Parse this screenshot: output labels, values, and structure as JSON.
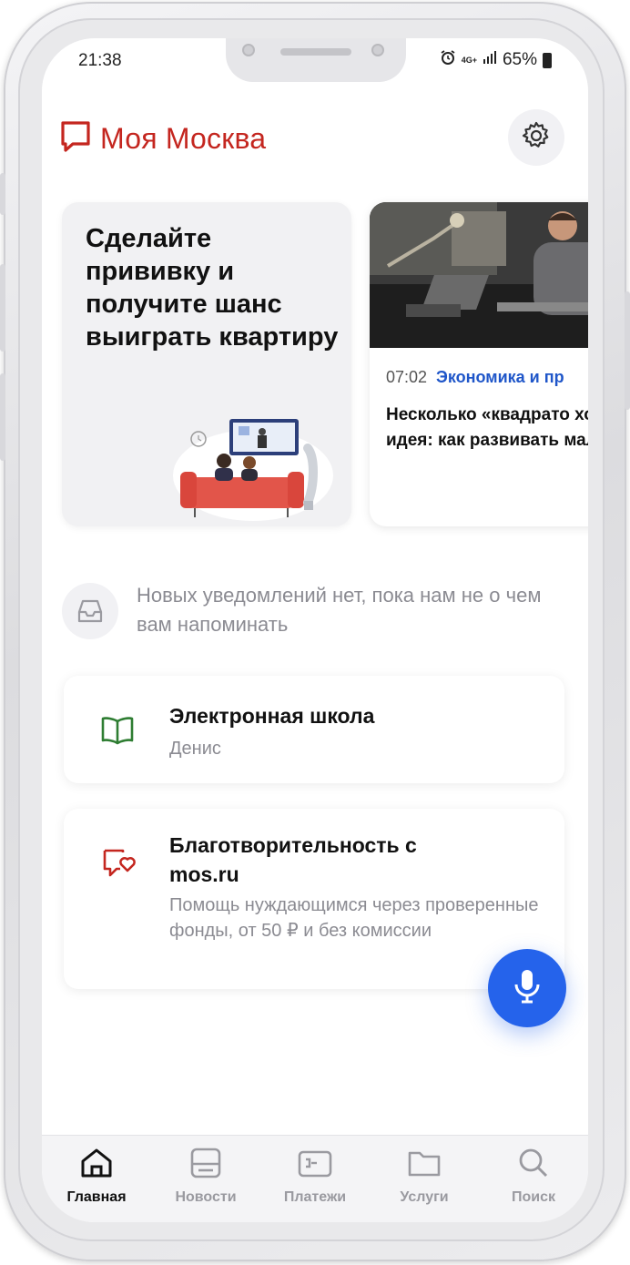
{
  "status_bar": {
    "time": "21:38",
    "network": "4G+",
    "battery": "65%"
  },
  "header": {
    "app_title": "Моя Москва",
    "logo_icon": "speech-bubble-icon",
    "settings_icon": "gear-icon"
  },
  "promo": {
    "title": "Сделайте прививку и получите шанс выиграть квартиру"
  },
  "news": {
    "time": "07:02",
    "category": "Экономика и пр",
    "title": "Несколько «квадрато хорошая идея: как развивать малый бизн"
  },
  "notification": {
    "text": "Новых уведомлений нет, пока нам не о чем вам напоминать"
  },
  "services": [
    {
      "title": "Электронная школа",
      "subtitle": "Денис",
      "icon": "open-book-icon"
    },
    {
      "title": "Благотворительность с mos.ru",
      "subtitle": "Помощь нуждающимся через проверенные фонды, от 50 ₽ и без комиссии",
      "icon": "heart-message-icon"
    }
  ],
  "bottom_nav": [
    {
      "label": "Главная",
      "icon": "home-icon",
      "active": true
    },
    {
      "label": "Новости",
      "icon": "news-icon",
      "active": false
    },
    {
      "label": "Платежи",
      "icon": "wallet-icon",
      "active": false
    },
    {
      "label": "Услуги",
      "icon": "folder-icon",
      "active": false
    },
    {
      "label": "Поиск",
      "icon": "search-icon",
      "active": false
    }
  ],
  "colors": {
    "brand_red": "#c4261f",
    "accent_blue": "#2563eb",
    "school_green": "#2e7d32"
  }
}
